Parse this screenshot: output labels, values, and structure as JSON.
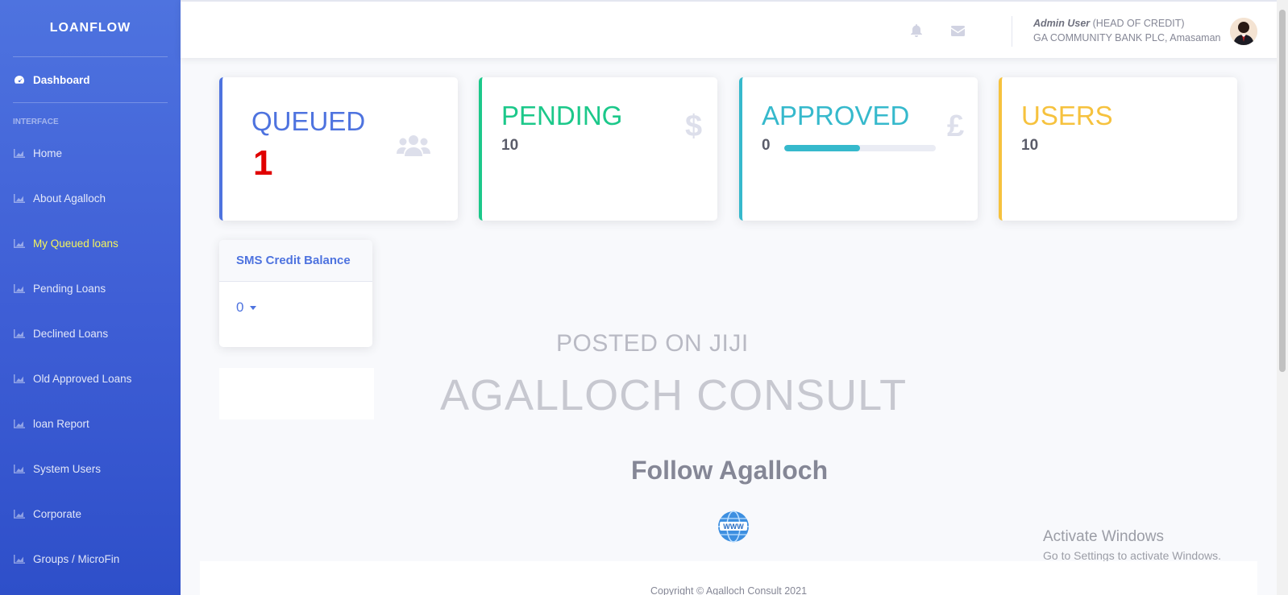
{
  "brand": "LOANFLOW",
  "sidebar": {
    "dashboard": "Dashboard",
    "section": "INTERFACE",
    "items": [
      {
        "label": "Home"
      },
      {
        "label": "About Agalloch"
      },
      {
        "label": "My Queued loans"
      },
      {
        "label": "Pending Loans"
      },
      {
        "label": "Declined Loans"
      },
      {
        "label": "Old Approved Loans"
      },
      {
        "label": "loan Report"
      },
      {
        "label": "System Users"
      },
      {
        "label": "Corporate"
      },
      {
        "label": "Groups / MicroFin"
      }
    ]
  },
  "topbar": {
    "user_name": "Admin User",
    "user_role": "(HEAD OF CREDIT)",
    "org": "GA COMMUNITY BANK PLC, Amasaman"
  },
  "stats": {
    "queued": {
      "title": "QUEUED",
      "value": "1",
      "color": "#4e73df"
    },
    "pending": {
      "title": "PENDING",
      "value": "10",
      "color": "#1cc88a"
    },
    "approved": {
      "title": "APPROVED",
      "value": "0",
      "color": "#36b9cc",
      "progress": 0.5
    },
    "users": {
      "title": "USERS",
      "value": "10",
      "color": "#f6c23e"
    }
  },
  "sms": {
    "title": "SMS Credit Balance",
    "value": "0"
  },
  "banner": {
    "posted": "POSTED ON JIJI",
    "company": "AGALLOCH CONSULT",
    "follow": "Follow Agalloch",
    "www": "WWW"
  },
  "windows": {
    "line1": "Activate Windows",
    "line2": "Go to Settings to activate Windows."
  },
  "footer": {
    "copyright": "Copyright © Agalloch Consult 2021"
  }
}
